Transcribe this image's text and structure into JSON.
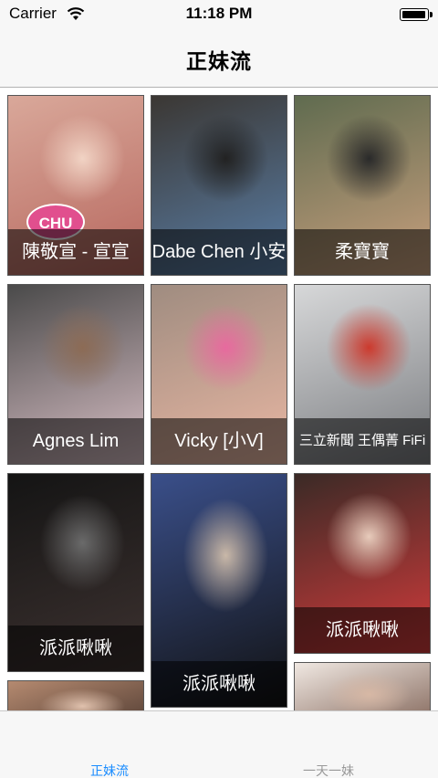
{
  "status_bar": {
    "carrier": "Carrier",
    "time": "11:18 PM",
    "wifi_icon": "wifi-icon",
    "battery_icon": "battery-icon"
  },
  "nav": {
    "title": "正妹流"
  },
  "cards": [
    {
      "name": "陳敬宣 - 宣宣",
      "badge": "CHU",
      "colors": [
        "#d9a89a",
        "#b7675e",
        "#f1d3c4"
      ]
    },
    {
      "name": "Dabe Chen 小安",
      "colors": [
        "#3b3733",
        "#5a7fa8",
        "#222222"
      ]
    },
    {
      "name": "柔寶寶",
      "colors": [
        "#5f6b4f",
        "#c9a07e",
        "#2a2a2a"
      ]
    },
    {
      "name": "Agnes Lim",
      "colors": [
        "#4a4a4a",
        "#d8bfc5",
        "#8c6b55"
      ]
    },
    {
      "name": "Vicky [小V]",
      "colors": [
        "#9f8c80",
        "#e9b7a3",
        "#e76a9e"
      ]
    },
    {
      "name": "三立新聞 王偶菁 FiFi",
      "colors": [
        "#d7d8d9",
        "#7a7c80",
        "#cc3a2e"
      ]
    },
    {
      "name": "派派啾啾",
      "colors": [
        "#141414",
        "#3d3230",
        "#6a6a6a"
      ]
    },
    {
      "name": "派派啾啾",
      "colors": [
        "#3a4f8a",
        "#111111",
        "#c9b8a8"
      ]
    },
    {
      "name": "派派啾啾",
      "colors": [
        "#3a2a26",
        "#d33b3b",
        "#e7cbbb"
      ]
    },
    {
      "name": "",
      "colors": [
        "#b58a70",
        "#3b2b25",
        "#e0c1ad"
      ]
    },
    {
      "name": "",
      "colors": [
        "#f0e8e2",
        "#6b4a3c",
        "#d7b8a5"
      ]
    }
  ],
  "tab_bar": {
    "tabs": [
      {
        "label": "正妹流",
        "active": true
      },
      {
        "label": "一天一妹",
        "active": false
      }
    ],
    "accent": "#1a8cff"
  }
}
